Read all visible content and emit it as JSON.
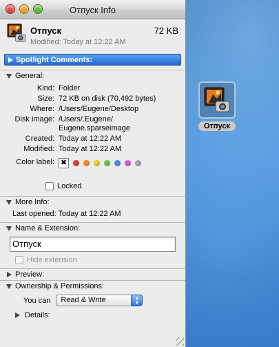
{
  "window": {
    "title": "Отпуск Info"
  },
  "header": {
    "name": "Отпуск",
    "size": "72 KB",
    "modified": "Modified: Today at 12:22 AM"
  },
  "spotlight": {
    "label": "Spotlight Comments:"
  },
  "general": {
    "label": "General:",
    "rows": [
      {
        "key": "Kind:",
        "value": "Folder"
      },
      {
        "key": "Size:",
        "value": "72 KB on disk (70,492 bytes)"
      },
      {
        "key": "Where:",
        "value": "/Users/Eugene/Desktop"
      },
      {
        "key": "Disk image:",
        "value": "/Users/.Eugene/\nEugene.sparseimage"
      },
      {
        "key": "Created:",
        "value": "Today at 12:22 AM"
      },
      {
        "key": "Modified:",
        "value": "Today at 12:22 AM"
      }
    ],
    "color_label_key": "Color label:",
    "color_label_none": "✖",
    "color_labels": [
      "#e8403a",
      "#f29320",
      "#f0cf2a",
      "#6ac64a",
      "#4b8ee8",
      "#d75fd0",
      "#a9a9a9"
    ],
    "locked_label": "Locked"
  },
  "more_info": {
    "label": "More Info:",
    "last_opened": "Last opened: Today at 12:22 AM"
  },
  "name_extension": {
    "label": "Name & Extension:",
    "name_value": "Отпуск",
    "hide_extension_label": "Hide extension"
  },
  "preview": {
    "label": "Preview:"
  },
  "ownership": {
    "label": "Ownership & Permissions:",
    "you_can_label": "You can",
    "permission_value": "Read & Write",
    "details_label": "Details:"
  },
  "desktop": {
    "icon_label": "Отпуск"
  }
}
